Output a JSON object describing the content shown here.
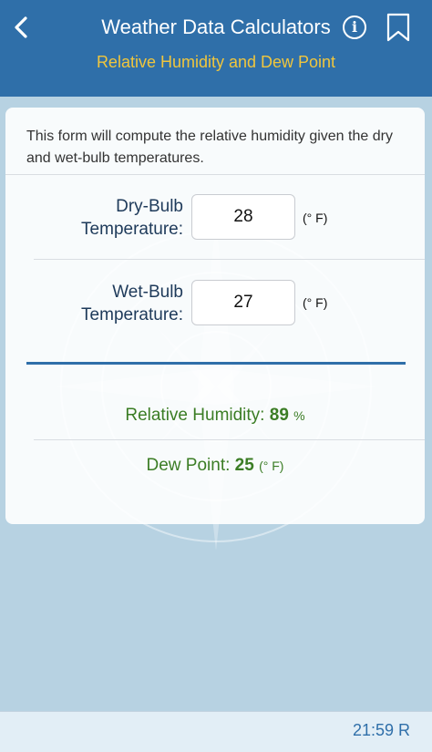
{
  "header": {
    "title": "Weather Data Calculators",
    "subtitle": "Relative Humidity and Dew Point",
    "info_glyph": "i"
  },
  "form": {
    "intro": "This form will compute the relative humidity given the dry and wet-bulb temperatures.",
    "dry_bulb": {
      "label_line1": "Dry-Bulb",
      "label_line2": "Temperature:",
      "value": "28",
      "unit": "(° F)"
    },
    "wet_bulb": {
      "label_line1": "Wet-Bulb",
      "label_line2": "Temperature:",
      "value": "27",
      "unit": "(° F)"
    }
  },
  "results": {
    "rh_label": "Relative Humidity:",
    "rh_value": "89",
    "rh_unit": "%",
    "dp_label": "Dew Point:",
    "dp_value": "25",
    "dp_unit": "(° F)"
  },
  "footer": {
    "clock": "21:59 R"
  },
  "colors": {
    "header": "#2f6fa9",
    "subtitle": "#f0c63d",
    "result": "#3b7d25",
    "background": "#b7d2e2"
  },
  "icons": {
    "back": "chevron-left-icon",
    "info": "info-circle-icon",
    "bookmark": "bookmark-icon",
    "background": "compass-rose-icon"
  }
}
